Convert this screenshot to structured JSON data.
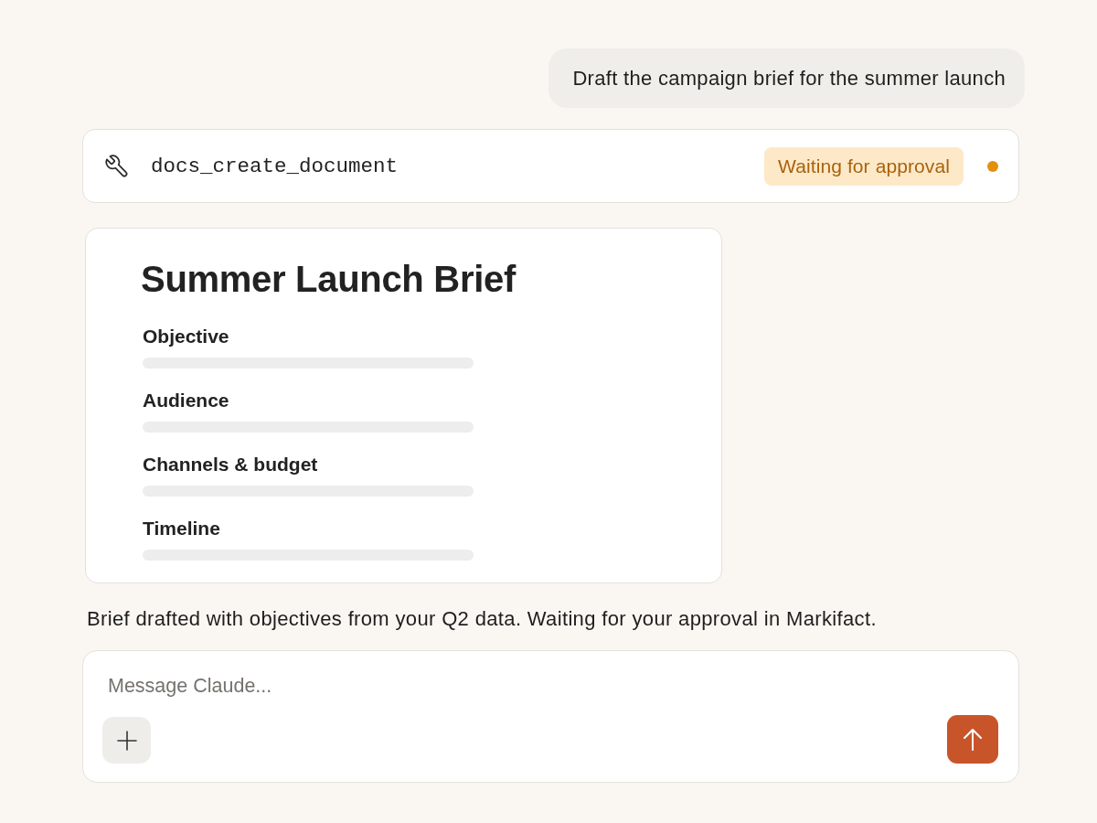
{
  "user_message": {
    "text": "Draft the campaign brief for the summer launch"
  },
  "tool_call": {
    "name": "docs_create_document",
    "status": {
      "label": "Waiting for approval",
      "kind": "pending"
    }
  },
  "document": {
    "title": "Summer Launch Brief",
    "sections": [
      {
        "heading": "Objective"
      },
      {
        "heading": "Audience"
      },
      {
        "heading": "Channels & budget"
      },
      {
        "heading": "Timeline"
      }
    ]
  },
  "assistant_message": {
    "text": "Brief drafted with objectives from your Q2 data. Waiting for your approval in Markifact."
  },
  "composer": {
    "placeholder": "Message Claude..."
  }
}
